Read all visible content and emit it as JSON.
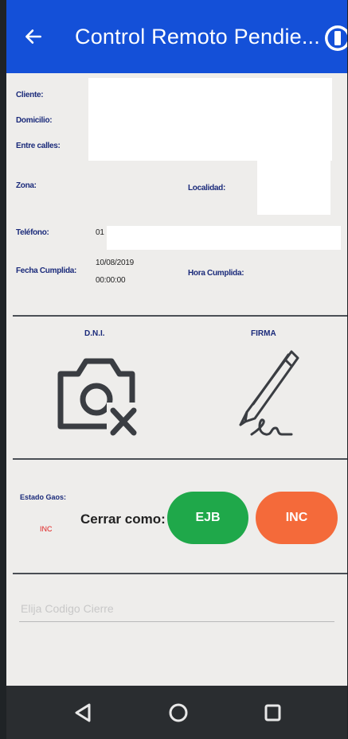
{
  "appbar": {
    "title": "Control Remoto Pendie...",
    "back_icon": "arrow-left-icon",
    "info_icon": "info-icon",
    "color": "#1450d8"
  },
  "info": {
    "cliente_label": "Cliente:",
    "domicilio_label": "Domicilio:",
    "entre_calles_label": "Entre calles:",
    "zona_label": "Zona:",
    "localidad_label": "Localidad:",
    "telefono_label": "Teléfono:",
    "telefono_value": "01",
    "fecha_label": "Fecha Cumplida:",
    "fecha_value_date": "10/08/2019",
    "fecha_value_time": "00:00:00",
    "hora_label": "Hora Cumplida:"
  },
  "evidence": {
    "dni_label": "D.N.I.",
    "dni_icon": "camera-off-icon",
    "firma_label": "FIRMA",
    "firma_icon": "pen-signature-icon"
  },
  "close": {
    "estado_label": "Estado Gaos:",
    "estado_value": "INC",
    "cerrar_label": "Cerrar como:",
    "ejb_label": "EJB",
    "ejb_color": "#1fa84a",
    "inc_label": "INC",
    "inc_color": "#f46a3a"
  },
  "code": {
    "placeholder": "Elija Codigo Cierre",
    "value": ""
  },
  "navbar": {
    "back_icon": "nav-back-icon",
    "home_icon": "nav-home-icon",
    "recents_icon": "nav-recents-icon"
  }
}
